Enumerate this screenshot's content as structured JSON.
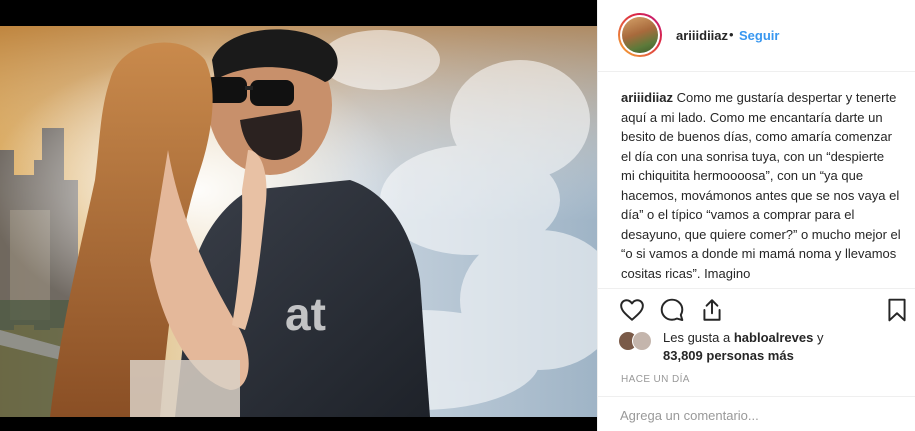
{
  "post": {
    "username": "ariiidiiaz",
    "separator": "•",
    "follow_label": "Seguir",
    "caption_user": "ariiidiiaz",
    "caption_text": "Como me gustaría despertar y tenerte aquí a mi lado. Como me encantaría darte un besito de buenos días, como amaría comenzar el día con una sonrisa tuya, con un “despierte mi chiquitita hermoooosa”, con un “ya que hacemos, movámonos antes que se nos vaya el día” o el típico “vamos a comprar para el desayuno, que quiere comer?” o mucho mejor el “o si vamos a donde mi mamá noma y llevamos cositas ricas”. Imagino",
    "likes_prefix": "Les gusta a",
    "likes_user": "hablоalreves",
    "likes_and": "y",
    "likes_count": "83,809 personas más",
    "timestamp": "HACE UN DÍA",
    "comment_placeholder": "Agrega un comentario..."
  },
  "icons": {
    "like": "heart-icon",
    "comment": "comment-icon",
    "share": "share-icon",
    "save": "bookmark-icon"
  },
  "colors": {
    "link": "#3897f0",
    "text": "#262626",
    "muted": "#999999",
    "divider": "#efefef"
  }
}
